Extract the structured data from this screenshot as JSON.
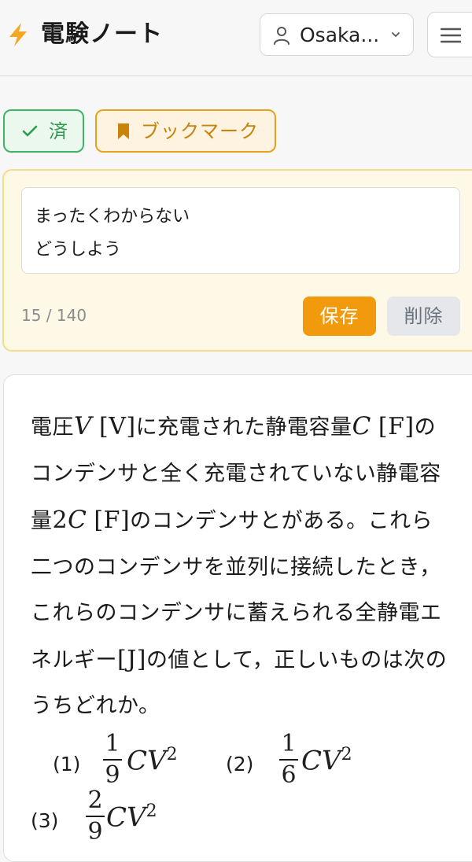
{
  "header": {
    "app_title": "電験ノート",
    "user_name": "Osaka...",
    "accent_color": "#f5a623"
  },
  "tags": {
    "done_label": "済",
    "bookmark_label": "ブックマーク"
  },
  "note": {
    "text": "まったくわからない\nどうしよう",
    "counter": "15 / 140",
    "save_label": "保存",
    "delete_label": "削除"
  },
  "question": {
    "t1": "電圧",
    "v_var": "V",
    "v_unit": "[V]",
    "t2": "に充電された静電容量",
    "c_var": "C",
    "f_unit": "[F]",
    "t3": "のコンデンサと全く充電されていない静電容量",
    "two_c": "2",
    "c_var2": "C",
    "f_unit2": "[F]",
    "t4": "のコンデンサとがある。これら二つのコンデンサを並列に接続したとき，これらのコンデンサに蓄えられる全静電エネルギー",
    "j_unit": "[J]",
    "t5": "の値として，正しいものは次のうちどれか。",
    "choices": [
      {
        "label": "(1)",
        "num": "1",
        "den": "9",
        "expr": "CV",
        "exp": "2"
      },
      {
        "label": "(2)",
        "num": "1",
        "den": "6",
        "expr": "CV",
        "exp": "2"
      },
      {
        "label": "(3)",
        "num": "2",
        "den": "9",
        "expr": "CV",
        "exp": "2"
      }
    ]
  }
}
